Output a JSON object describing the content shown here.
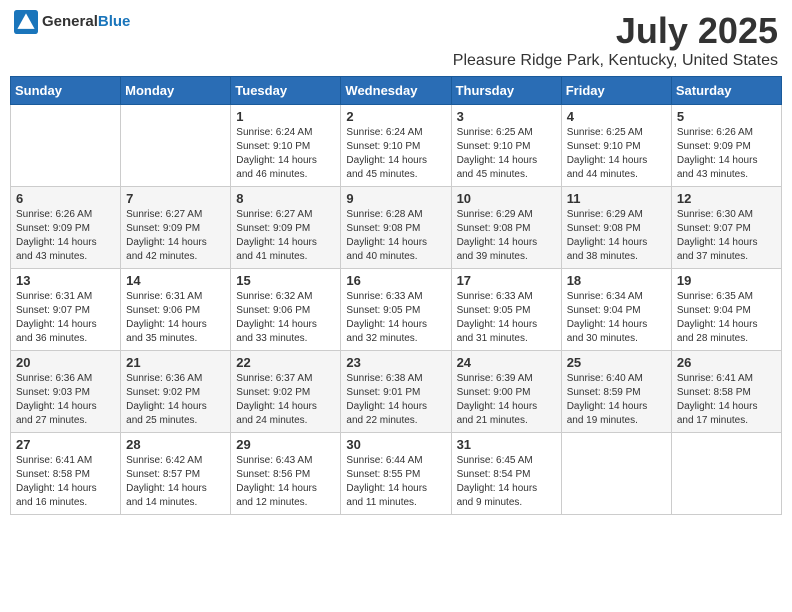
{
  "header": {
    "logo_general": "General",
    "logo_blue": "Blue",
    "title": "July 2025",
    "location": "Pleasure Ridge Park, Kentucky, United States"
  },
  "days_of_week": [
    "Sunday",
    "Monday",
    "Tuesday",
    "Wednesday",
    "Thursday",
    "Friday",
    "Saturday"
  ],
  "weeks": [
    [
      {
        "day": "",
        "sunrise": "",
        "sunset": "",
        "daylight": ""
      },
      {
        "day": "",
        "sunrise": "",
        "sunset": "",
        "daylight": ""
      },
      {
        "day": "1",
        "sunrise": "Sunrise: 6:24 AM",
        "sunset": "Sunset: 9:10 PM",
        "daylight": "Daylight: 14 hours and 46 minutes."
      },
      {
        "day": "2",
        "sunrise": "Sunrise: 6:24 AM",
        "sunset": "Sunset: 9:10 PM",
        "daylight": "Daylight: 14 hours and 45 minutes."
      },
      {
        "day": "3",
        "sunrise": "Sunrise: 6:25 AM",
        "sunset": "Sunset: 9:10 PM",
        "daylight": "Daylight: 14 hours and 45 minutes."
      },
      {
        "day": "4",
        "sunrise": "Sunrise: 6:25 AM",
        "sunset": "Sunset: 9:10 PM",
        "daylight": "Daylight: 14 hours and 44 minutes."
      },
      {
        "day": "5",
        "sunrise": "Sunrise: 6:26 AM",
        "sunset": "Sunset: 9:09 PM",
        "daylight": "Daylight: 14 hours and 43 minutes."
      }
    ],
    [
      {
        "day": "6",
        "sunrise": "Sunrise: 6:26 AM",
        "sunset": "Sunset: 9:09 PM",
        "daylight": "Daylight: 14 hours and 43 minutes."
      },
      {
        "day": "7",
        "sunrise": "Sunrise: 6:27 AM",
        "sunset": "Sunset: 9:09 PM",
        "daylight": "Daylight: 14 hours and 42 minutes."
      },
      {
        "day": "8",
        "sunrise": "Sunrise: 6:27 AM",
        "sunset": "Sunset: 9:09 PM",
        "daylight": "Daylight: 14 hours and 41 minutes."
      },
      {
        "day": "9",
        "sunrise": "Sunrise: 6:28 AM",
        "sunset": "Sunset: 9:08 PM",
        "daylight": "Daylight: 14 hours and 40 minutes."
      },
      {
        "day": "10",
        "sunrise": "Sunrise: 6:29 AM",
        "sunset": "Sunset: 9:08 PM",
        "daylight": "Daylight: 14 hours and 39 minutes."
      },
      {
        "day": "11",
        "sunrise": "Sunrise: 6:29 AM",
        "sunset": "Sunset: 9:08 PM",
        "daylight": "Daylight: 14 hours and 38 minutes."
      },
      {
        "day": "12",
        "sunrise": "Sunrise: 6:30 AM",
        "sunset": "Sunset: 9:07 PM",
        "daylight": "Daylight: 14 hours and 37 minutes."
      }
    ],
    [
      {
        "day": "13",
        "sunrise": "Sunrise: 6:31 AM",
        "sunset": "Sunset: 9:07 PM",
        "daylight": "Daylight: 14 hours and 36 minutes."
      },
      {
        "day": "14",
        "sunrise": "Sunrise: 6:31 AM",
        "sunset": "Sunset: 9:06 PM",
        "daylight": "Daylight: 14 hours and 35 minutes."
      },
      {
        "day": "15",
        "sunrise": "Sunrise: 6:32 AM",
        "sunset": "Sunset: 9:06 PM",
        "daylight": "Daylight: 14 hours and 33 minutes."
      },
      {
        "day": "16",
        "sunrise": "Sunrise: 6:33 AM",
        "sunset": "Sunset: 9:05 PM",
        "daylight": "Daylight: 14 hours and 32 minutes."
      },
      {
        "day": "17",
        "sunrise": "Sunrise: 6:33 AM",
        "sunset": "Sunset: 9:05 PM",
        "daylight": "Daylight: 14 hours and 31 minutes."
      },
      {
        "day": "18",
        "sunrise": "Sunrise: 6:34 AM",
        "sunset": "Sunset: 9:04 PM",
        "daylight": "Daylight: 14 hours and 30 minutes."
      },
      {
        "day": "19",
        "sunrise": "Sunrise: 6:35 AM",
        "sunset": "Sunset: 9:04 PM",
        "daylight": "Daylight: 14 hours and 28 minutes."
      }
    ],
    [
      {
        "day": "20",
        "sunrise": "Sunrise: 6:36 AM",
        "sunset": "Sunset: 9:03 PM",
        "daylight": "Daylight: 14 hours and 27 minutes."
      },
      {
        "day": "21",
        "sunrise": "Sunrise: 6:36 AM",
        "sunset": "Sunset: 9:02 PM",
        "daylight": "Daylight: 14 hours and 25 minutes."
      },
      {
        "day": "22",
        "sunrise": "Sunrise: 6:37 AM",
        "sunset": "Sunset: 9:02 PM",
        "daylight": "Daylight: 14 hours and 24 minutes."
      },
      {
        "day": "23",
        "sunrise": "Sunrise: 6:38 AM",
        "sunset": "Sunset: 9:01 PM",
        "daylight": "Daylight: 14 hours and 22 minutes."
      },
      {
        "day": "24",
        "sunrise": "Sunrise: 6:39 AM",
        "sunset": "Sunset: 9:00 PM",
        "daylight": "Daylight: 14 hours and 21 minutes."
      },
      {
        "day": "25",
        "sunrise": "Sunrise: 6:40 AM",
        "sunset": "Sunset: 8:59 PM",
        "daylight": "Daylight: 14 hours and 19 minutes."
      },
      {
        "day": "26",
        "sunrise": "Sunrise: 6:41 AM",
        "sunset": "Sunset: 8:58 PM",
        "daylight": "Daylight: 14 hours and 17 minutes."
      }
    ],
    [
      {
        "day": "27",
        "sunrise": "Sunrise: 6:41 AM",
        "sunset": "Sunset: 8:58 PM",
        "daylight": "Daylight: 14 hours and 16 minutes."
      },
      {
        "day": "28",
        "sunrise": "Sunrise: 6:42 AM",
        "sunset": "Sunset: 8:57 PM",
        "daylight": "Daylight: 14 hours and 14 minutes."
      },
      {
        "day": "29",
        "sunrise": "Sunrise: 6:43 AM",
        "sunset": "Sunset: 8:56 PM",
        "daylight": "Daylight: 14 hours and 12 minutes."
      },
      {
        "day": "30",
        "sunrise": "Sunrise: 6:44 AM",
        "sunset": "Sunset: 8:55 PM",
        "daylight": "Daylight: 14 hours and 11 minutes."
      },
      {
        "day": "31",
        "sunrise": "Sunrise: 6:45 AM",
        "sunset": "Sunset: 8:54 PM",
        "daylight": "Daylight: 14 hours and 9 minutes."
      },
      {
        "day": "",
        "sunrise": "",
        "sunset": "",
        "daylight": ""
      },
      {
        "day": "",
        "sunrise": "",
        "sunset": "",
        "daylight": ""
      }
    ]
  ]
}
